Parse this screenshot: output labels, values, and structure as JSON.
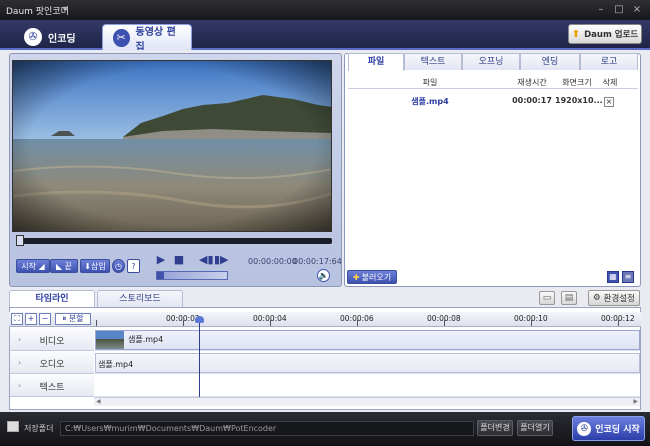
{
  "window": {
    "title": "Daum 팟인코더"
  },
  "main_tabs": [
    {
      "label": "인코딩"
    },
    {
      "label": "동영상 편집"
    }
  ],
  "upload_button": "Daum 업로드",
  "player": {
    "controls": {
      "start": "시작",
      "end": "끝",
      "insert": "삽입",
      "help": "?"
    },
    "current_time": "00:00:00:00",
    "total_time": "00:00:17:64"
  },
  "file_panel": {
    "tabs": [
      "파일",
      "텍스트",
      "오프닝",
      "엔딩",
      "로고"
    ],
    "headers": [
      "파일",
      "재생시간",
      "화면크기",
      "삭제"
    ],
    "rows": [
      {
        "file": "샘플.mp4",
        "duration": "00:00:17",
        "size": "1920x10...",
        "delete": "×"
      }
    ],
    "load_button": "불러오기"
  },
  "timeline": {
    "tabs": [
      "타임라인",
      "스토리보드"
    ],
    "settings_button": "환경설정",
    "split_label": "분할",
    "ruler_labels": [
      "00:00:02",
      "00:00:04",
      "00:00:06",
      "00:00:08",
      "00:00:10",
      "00:00:12"
    ],
    "tracks": [
      {
        "label": "비디오",
        "clip": "샘플.mp4"
      },
      {
        "label": "오디오",
        "clip": "샘플.mp4"
      },
      {
        "label": "텍스트",
        "clip": ""
      }
    ]
  },
  "statusbar": {
    "folder_label": "저장폴더",
    "path": "C:₩Users₩murim₩Documents₩Daum₩PotEncoder",
    "change_button": "폴더변경",
    "open_button": "폴더열기",
    "encode_button": "인코딩 시작"
  },
  "colors": {
    "accent": "#3d51b0",
    "dark": "#1b1b1f",
    "panel": "#b7c2e0"
  }
}
